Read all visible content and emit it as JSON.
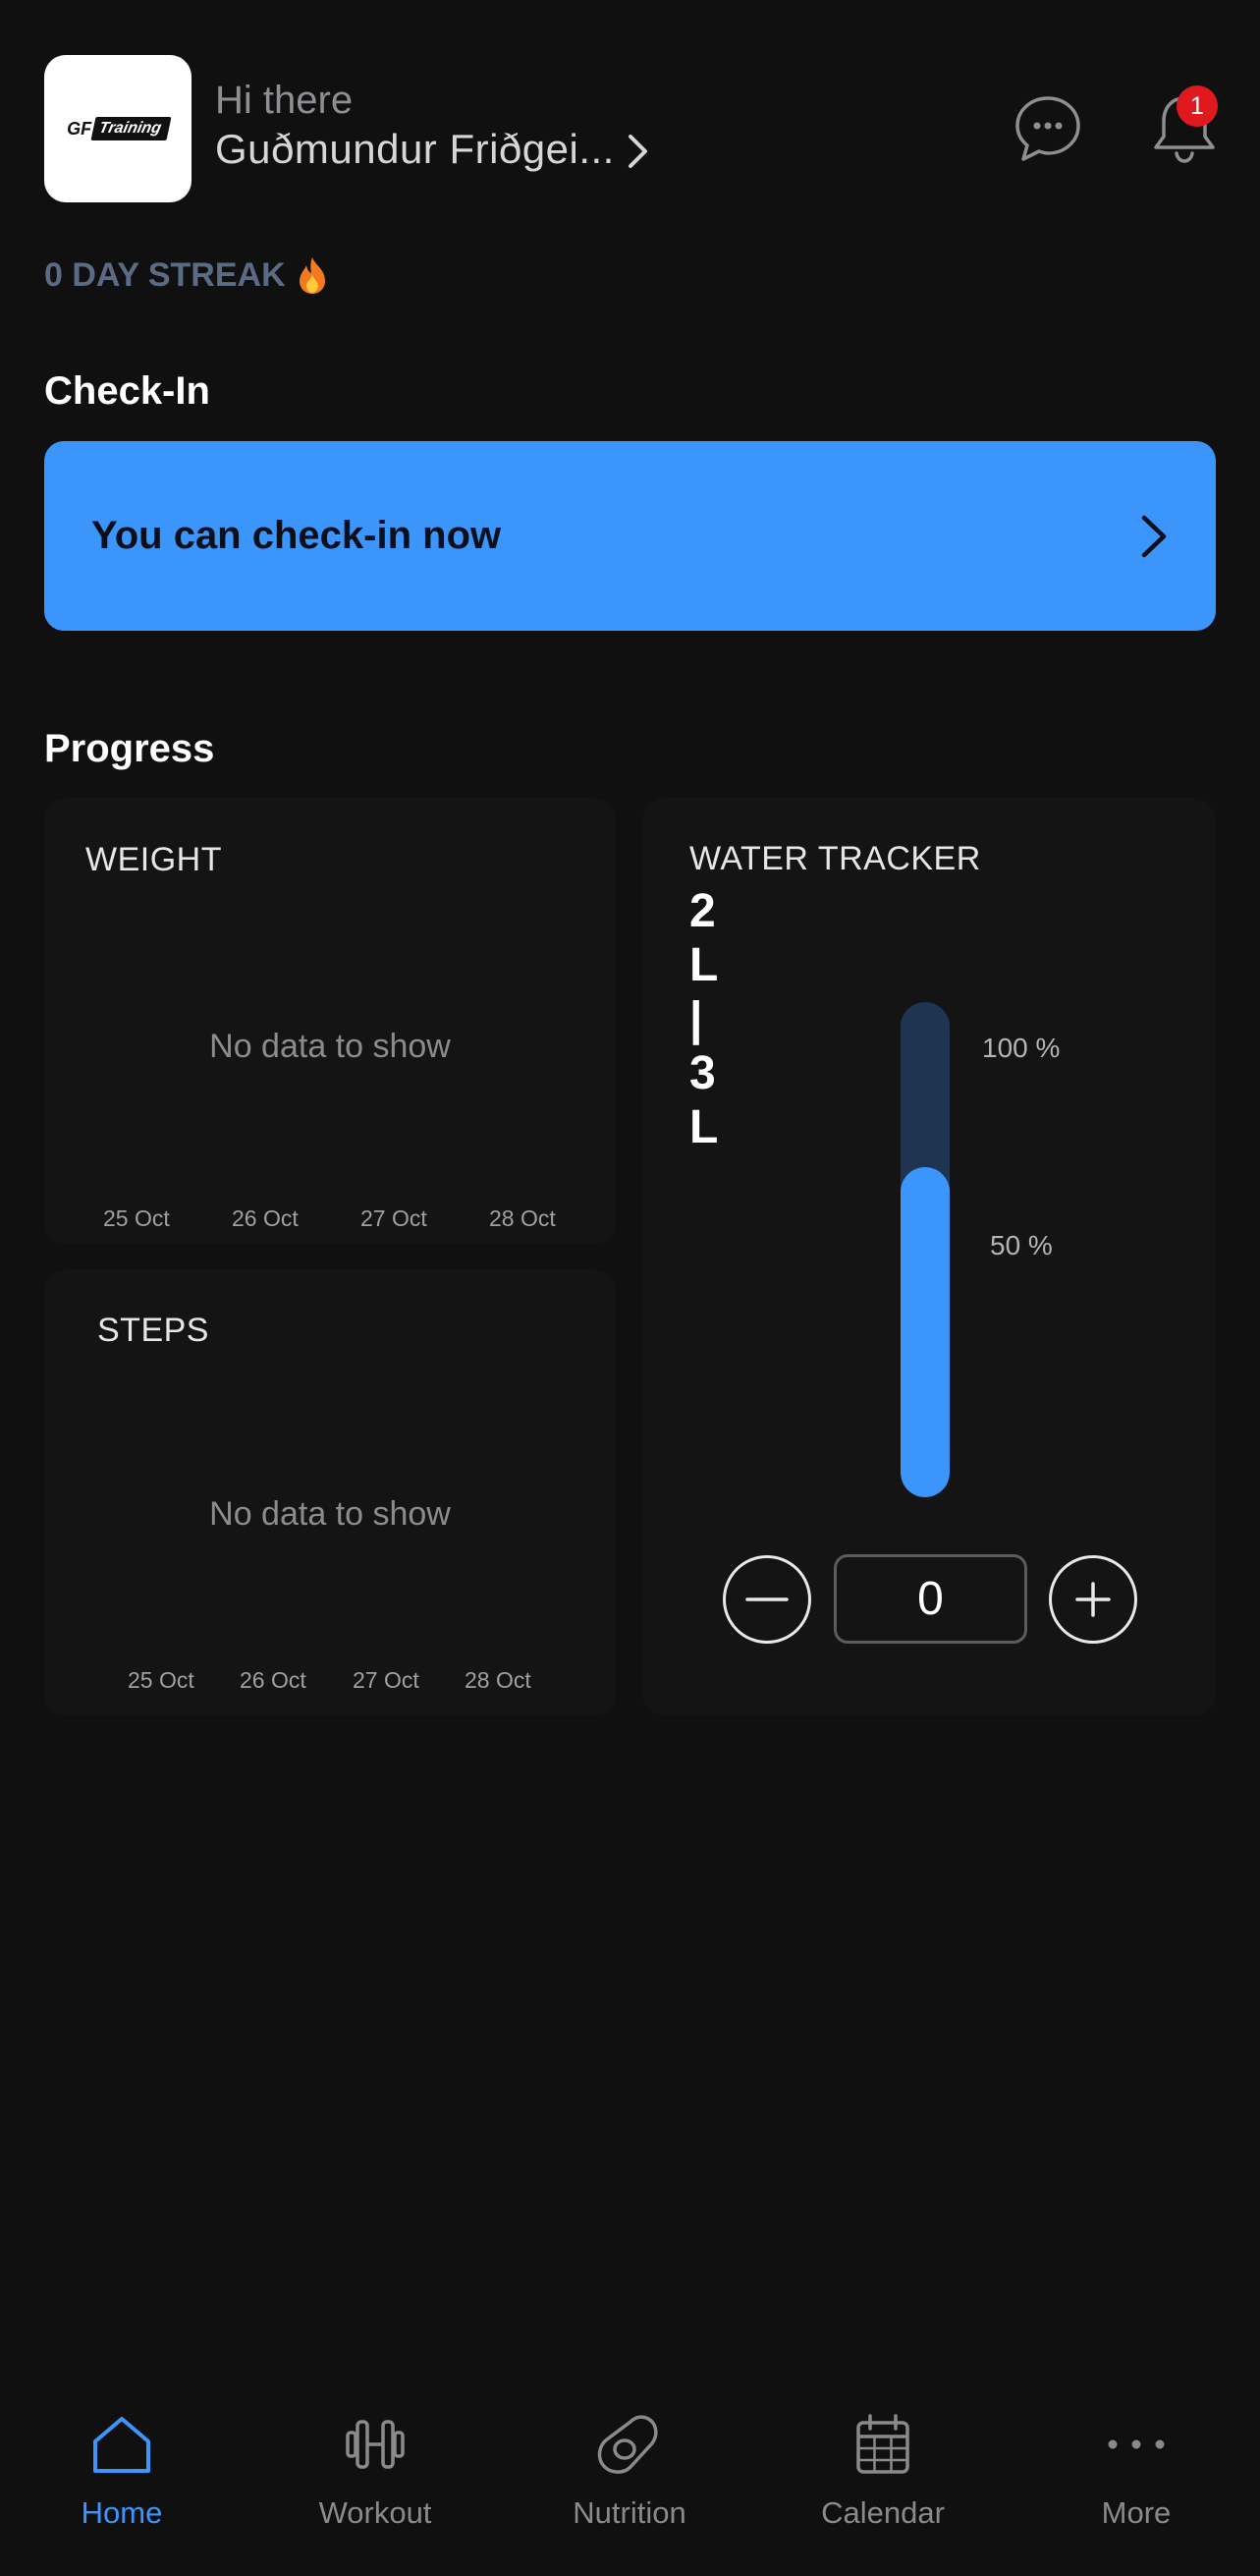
{
  "header": {
    "logo_text_gf": "GF",
    "logo_text_training": "Training",
    "greeting": "Hi there",
    "username": "Guðmundur  Friðgei...",
    "notification_count": "1"
  },
  "streak": {
    "label": "0 DAY STREAK",
    "icon": "fire-icon"
  },
  "checkin": {
    "section_title": "Check-In",
    "card_text": "You can check-in now"
  },
  "progress": {
    "section_title": "Progress",
    "weight": {
      "title": "WEIGHT",
      "empty_text": "No data to show",
      "dates": [
        "25 Oct",
        "26 Oct",
        "27 Oct",
        "28 Oct"
      ]
    },
    "steps": {
      "title": "STEPS",
      "empty_text": "No data to show",
      "dates": [
        "25 Oct",
        "26 Oct",
        "27 Oct",
        "28 Oct"
      ]
    },
    "water": {
      "title": "WATER TRACKER",
      "value": "2 L | 3 L",
      "level_percent": 66.7,
      "label_100": "100 %",
      "label_50": "50 %",
      "count": "0"
    }
  },
  "nav": {
    "items": [
      {
        "label": "Home",
        "icon": "home-icon",
        "active": true
      },
      {
        "label": "Workout",
        "icon": "dumbbell-icon",
        "active": false
      },
      {
        "label": "Nutrition",
        "icon": "avocado-icon",
        "active": false
      },
      {
        "label": "Calendar",
        "icon": "calendar-icon",
        "active": false
      },
      {
        "label": "More",
        "icon": "more-icon",
        "active": false
      }
    ]
  },
  "colors": {
    "accent": "#3c95fa",
    "background": "#101010",
    "badge": "#e0191e"
  }
}
